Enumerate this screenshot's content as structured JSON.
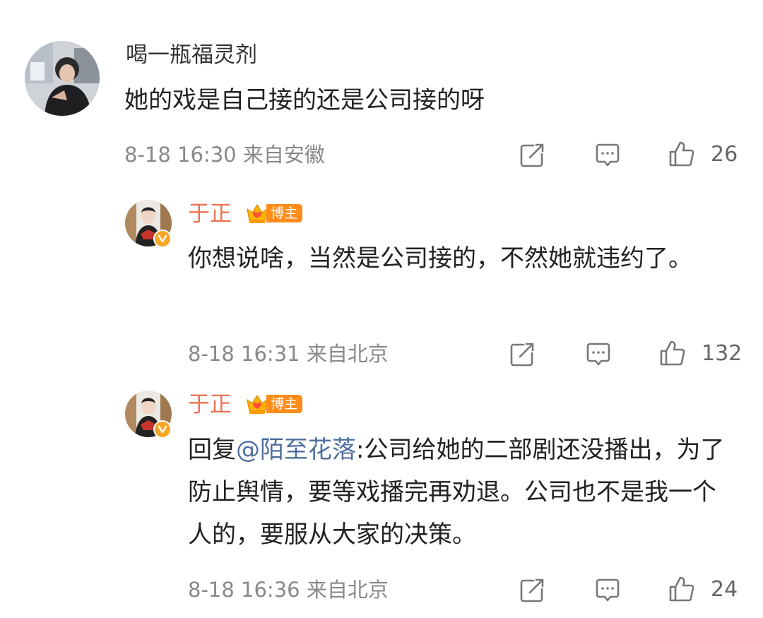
{
  "comments": [
    {
      "username": "喝一瓶福灵剂",
      "content": "她的戏是自己接的还是公司接的呀",
      "time": "8-18 16:30",
      "location": "来自安徽",
      "likes": "26",
      "icons": {
        "avatar": "user-avatar",
        "share": "share-icon",
        "comment": "comment-icon",
        "like": "thumbs-up-icon"
      }
    },
    {
      "username": "于正",
      "badge": "博主",
      "content": "你想说啥，当然是公司接的，不然她就违约了。",
      "time": "8-18 16:31",
      "location": "来自北京",
      "likes": "132",
      "icons": {
        "avatar": "user-avatar",
        "verified": "verified-badge-icon",
        "crown": "crown-icon",
        "share": "share-icon",
        "comment": "comment-icon",
        "like": "thumbs-up-icon"
      }
    },
    {
      "username": "于正",
      "badge": "博主",
      "reply_prefix": "回复",
      "mention": "@陌至花落",
      "content": ":公司给她的二部剧还没播出，为了防止舆情，要等戏播完再劝退。公司也不是我一个人的，要服从大家的决策。",
      "time": "8-18 16:36",
      "location": "来自北京",
      "likes": "24",
      "icons": {
        "avatar": "user-avatar",
        "verified": "verified-badge-icon",
        "crown": "crown-icon",
        "share": "share-icon",
        "comment": "comment-icon",
        "like": "thumbs-up-icon"
      }
    }
  ],
  "colors": {
    "reply_username": "#eb7350",
    "mention": "#4d6e9e",
    "badge": "#ff8c1a",
    "verified": "#f6a623",
    "meta": "#888888"
  }
}
